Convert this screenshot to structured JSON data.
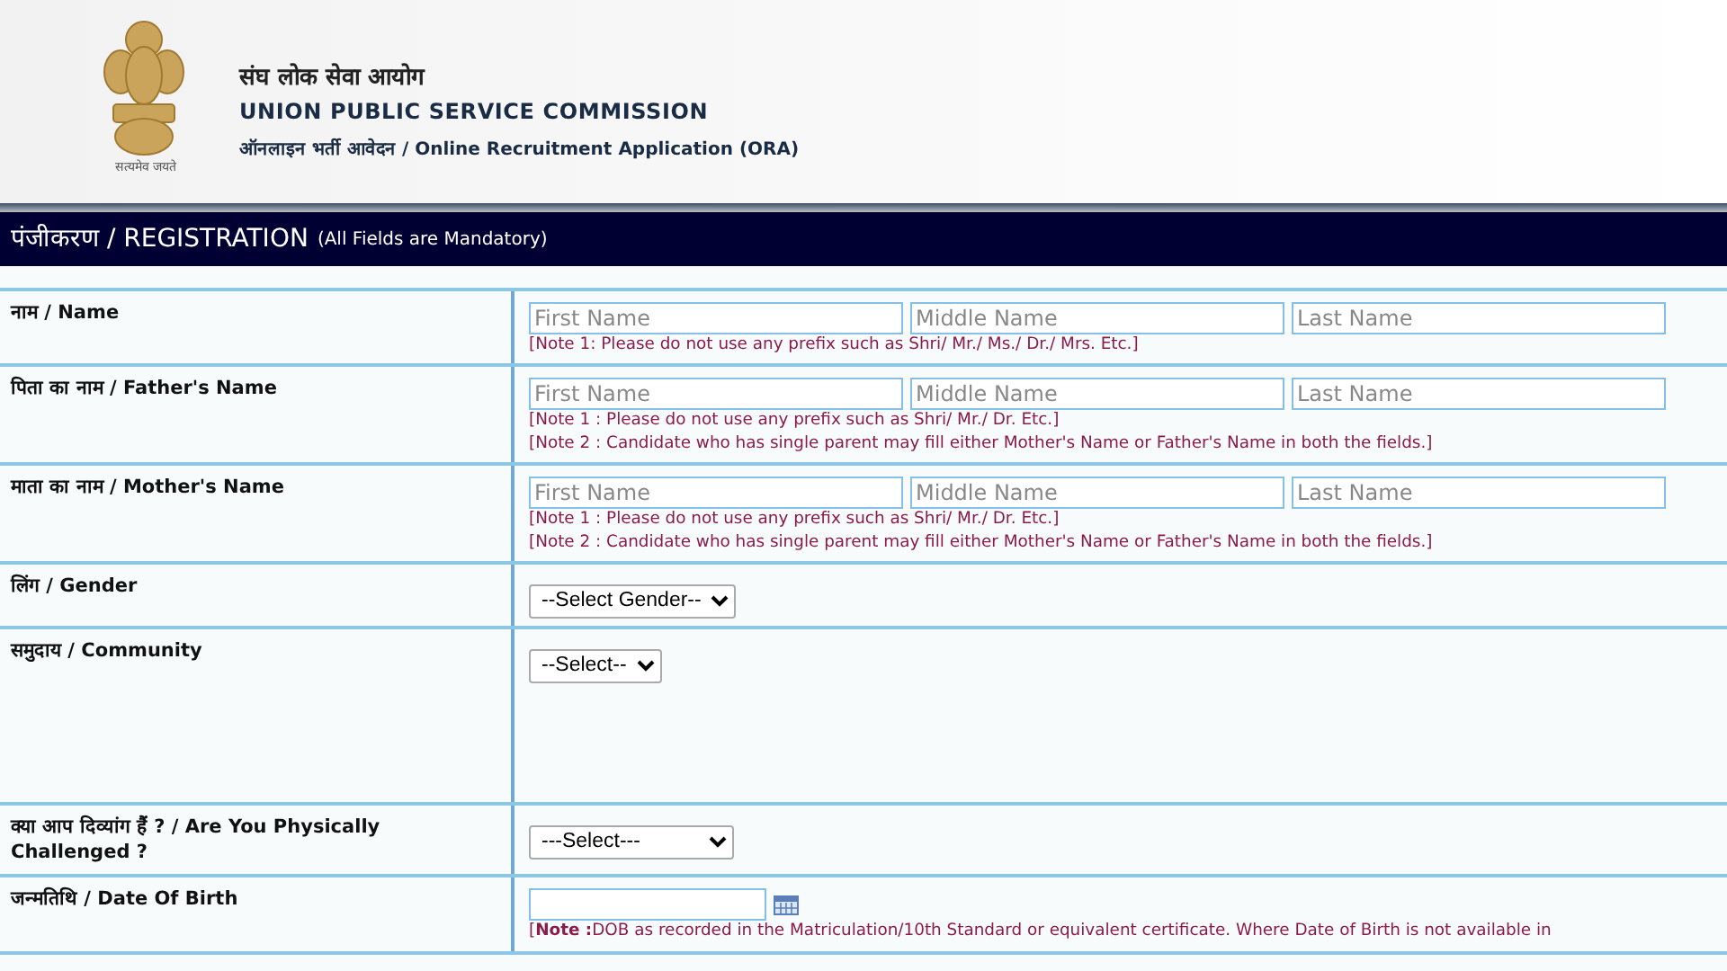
{
  "header": {
    "motto": "सत्यमेव जयते",
    "title_hindi": "संघ लोक सेवा आयोग",
    "title": "UNION PUBLIC SERVICE COMMISSION",
    "subtitle": "ऑनलाइन भर्ती आवेदन / Online Recruitment Application (ORA)"
  },
  "section": {
    "title": "पंजीकरण / REGISTRATION",
    "note": "(All Fields are Mandatory)"
  },
  "rows": [
    {
      "kind": "names",
      "label": "नाम / Name",
      "placeholders": [
        "First Name",
        "Middle Name",
        "Last Name"
      ],
      "notes": [
        "[Note 1: Please do not use any prefix such as Shri/ Mr./ Ms./ Dr./ Mrs. Etc.]"
      ]
    },
    {
      "kind": "names",
      "label": "पिता का नाम / Father's Name",
      "placeholders": [
        "First Name",
        "Middle Name",
        "Last Name"
      ],
      "notes": [
        "[Note 1 : Please do not use any prefix such as Shri/ Mr./ Dr. Etc.]",
        "[Note 2 : Candidate who has single parent may fill either Mother's Name or Father's Name in both the fields.]"
      ]
    },
    {
      "kind": "names",
      "label": "माता का नाम / Mother's Name",
      "placeholders": [
        "First Name",
        "Middle Name",
        "Last Name"
      ],
      "notes": [
        "[Note 1 : Please do not use any prefix such as Shri/ Mr./ Dr. Etc.]",
        "[Note 2 : Candidate who has single parent may fill either Mother's Name or Father's Name in both the fields.]"
      ]
    },
    {
      "kind": "select",
      "label": "लिंग / Gender",
      "value": "--Select Gender--"
    },
    {
      "kind": "select",
      "label": "समुदाय / Community",
      "value": "--Select--",
      "tall": true
    },
    {
      "kind": "select",
      "label": "क्या आप दिव्यांग हैं ? / Are You Physically Challenged ?",
      "value": "---Select---",
      "wide": true
    },
    {
      "kind": "date",
      "label": "जन्मतिथि / Date Of Birth",
      "notes": [
        "[**Note :**DOB as recorded in the Matriculation/10th Standard or equivalent certificate. Where Date of Birth is not available in"
      ]
    }
  ]
}
